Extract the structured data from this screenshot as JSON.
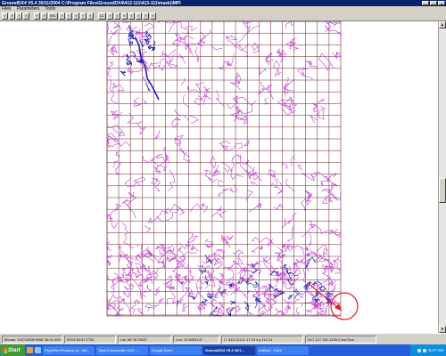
{
  "window": {
    "title": "GroundDX4 V5.4 30/11/2004  C:\\Program Files\\GroundDX4\\412-111\\413-111\\mask)\\MPI",
    "controls": [
      "_",
      "□",
      "x"
    ]
  },
  "menu": [
    "Files",
    "Parameters",
    "Tools"
  ],
  "toolbar": [
    {
      "label": "",
      "icon": "new-icon"
    },
    {
      "label": "",
      "icon": "open-icon"
    },
    {
      "label": "",
      "icon": "save-icon"
    },
    {
      "label": "",
      "icon": "print-icon"
    },
    {
      "label": "",
      "icon": "grid-icon"
    },
    {
      "label": "",
      "icon": "zoom-icon"
    },
    {
      "label": "WC",
      "icon": ""
    },
    {
      "label": "",
      "icon": "color-icon"
    },
    {
      "label": "",
      "icon": "water-icon"
    },
    {
      "label": "",
      "icon": "line-icon"
    },
    {
      "label": "",
      "icon": "layer-icon"
    },
    {
      "label": "",
      "icon": "fill-icon"
    },
    {
      "label": "LC",
      "icon": ""
    },
    {
      "label": "",
      "icon": "text-icon"
    },
    {
      "label": "",
      "icon": "tool-icon"
    },
    {
      "label": "",
      "icon": "zoom-in-icon"
    },
    {
      "label": "",
      "icon": "zoom-out-icon"
    },
    {
      "label": "",
      "icon": "nav-icon"
    },
    {
      "label": "",
      "icon": "select-icon"
    },
    {
      "label": "",
      "icon": "options-icon"
    }
  ],
  "map": {
    "grid_color": "#6a1b2b",
    "contour_color": "#c040c8",
    "water_color": "#1a22b0",
    "highlight_color": "#e8132c"
  },
  "status": {
    "mouse": "Mouse: 1927x2539  MSE 46.01.9915",
    "coords": "E013:50:57.1732",
    "lat": "Lat: 50:76:73007",
    "lon": "Lon: 13.8492147",
    "cell": "C: 413-111  A: 17.15  x,y 112.14",
    "file": "D17,127,152,1330.2 low Ena"
  },
  "taskbar": {
    "start": "Start",
    "tasks": [
      {
        "label": "FlightSim.Periskop.cz - Mo...",
        "active": false
      },
      {
        "label": "Total Commander 6.52 - ...",
        "active": false
      },
      {
        "label": "Google Earth",
        "active": false
      },
      {
        "label": "GroundDX4 V5.4 30/1...",
        "active": true
      },
      {
        "label": "untitled - Paint",
        "active": false
      }
    ],
    "time": "5:47 AM"
  }
}
